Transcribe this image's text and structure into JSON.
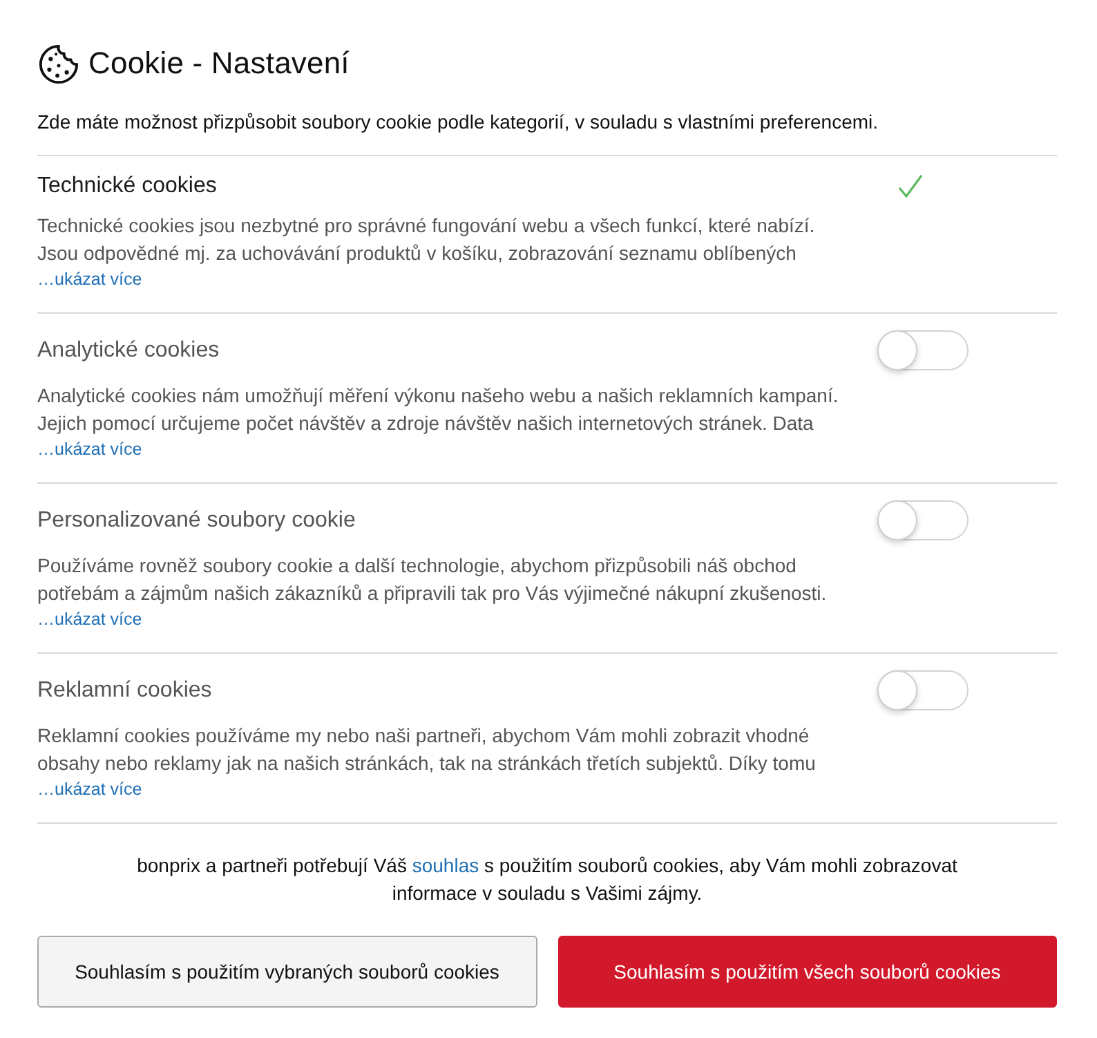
{
  "header": {
    "title": "Cookie - Nastavení",
    "intro": "Zde máte možnost přizpůsobit soubory cookie podle kategorií, v souladu s vlastními preferencemi."
  },
  "categories": [
    {
      "kind": "check",
      "on": true,
      "title": "Technické cookies",
      "description": "Technické cookies jsou nezbytné pro správné fungování webu a všech funkcí, které nabízí. Jsou odpovědné mj. za uchovávání produktů v košíku, zobrazování seznamu oblíbených",
      "more_link": "…ukázat více"
    },
    {
      "kind": "toggle",
      "on": false,
      "title": "Analytické cookies",
      "description": "Analytické cookies nám umožňují měření výkonu našeho webu a našich reklamních kampaní. Jejich pomocí určujeme počet návštěv a zdroje návštěv našich internetových stránek. Data",
      "more_link": "…ukázat více"
    },
    {
      "kind": "toggle",
      "on": false,
      "title": "Personalizované soubory cookie",
      "description": "Používáme rovněž soubory cookie a další technologie, abychom přizpůsobili náš obchod potřebám a zájmům našich zákazníků a připravili tak pro Vás výjimečné nákupní zkušenosti.",
      "more_link": "…ukázat více"
    },
    {
      "kind": "toggle",
      "on": false,
      "title": "Reklamní cookies",
      "description": "Reklamní cookies používáme my nebo naši partneři, abychom Vám mohli zobrazit vhodné obsahy nebo reklamy jak na našich stránkách, tak na stránkách třetích subjektů. Díky tomu",
      "more_link": "…ukázat více"
    }
  ],
  "consent": {
    "text_before": "bonprix a partneři potřebují Váš",
    "link": "souhlas",
    "text_after": "s použitím souborů cookies, aby Vám mohli zobrazovat informace v souladu s Vašimi zájmy."
  },
  "buttons": [
    {
      "kind": "secondary",
      "label": "Souhlasím s použitím vybraných souborů cookies"
    },
    {
      "kind": "primary",
      "label": "Souhlasím s použitím všech souborů cookies"
    }
  ]
}
